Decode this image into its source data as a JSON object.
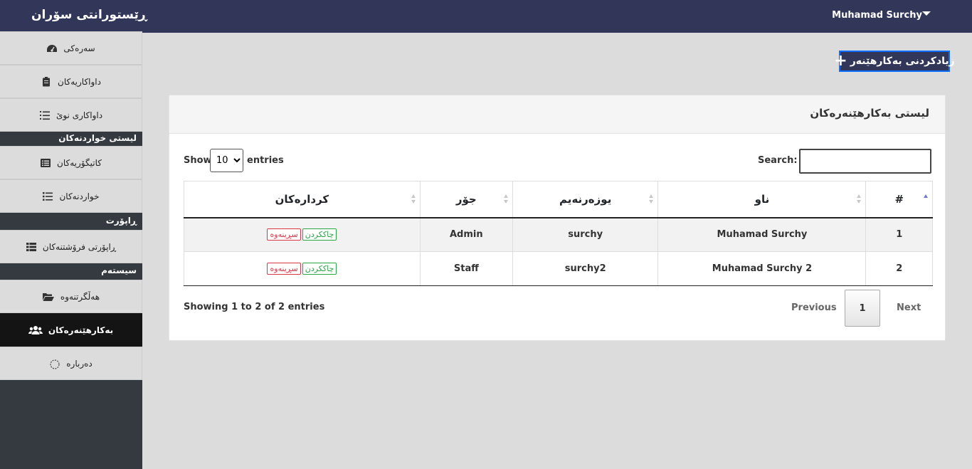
{
  "topbar": {
    "brand": "ڕێستورانتی سۆران",
    "user": "Muhamad Surchy"
  },
  "sidebar": {
    "items": [
      {
        "label": "سەرەکی",
        "icon": "dashboard-icon"
      },
      {
        "label": "داواکاریەکان",
        "icon": "clipboard-icon"
      },
      {
        "label": "داواکاری نوێ",
        "icon": "list-ol-icon"
      },
      {
        "label": "کاتیگۆریەکان",
        "icon": "list-alt-icon"
      },
      {
        "label": "خواردنەکان",
        "icon": "list-icon"
      },
      {
        "label": "ڕاپۆرتی فرۆشتنەکان",
        "icon": "th-list-icon"
      },
      {
        "label": "هەڵگرتنەوە",
        "icon": "folder-open-icon"
      },
      {
        "label": "بەکارهێنەرەکان",
        "icon": "users-icon"
      },
      {
        "label": "دەربارە",
        "icon": "circle-notch-icon"
      }
    ],
    "headers": [
      "لیستی خواردنەکان",
      "ڕاپۆرت",
      "سیستەم"
    ]
  },
  "add_button": {
    "label": "زیادکردنی بەکارهێنەر"
  },
  "card": {
    "title": "لیستی بەکارهێنەرەکان"
  },
  "datatable": {
    "show_label": "Show",
    "length_value": "10",
    "entries_label": "entries",
    "search_label": "Search:",
    "columns": [
      "#",
      "ناو",
      "یوزەرنەیم",
      "جۆر",
      "کردارەکان"
    ],
    "rows": [
      {
        "id": "1",
        "name": "Muhamad Surchy",
        "username": "surchy",
        "type": "Admin"
      },
      {
        "id": "2",
        "name": "Muhamad Surchy 2",
        "username": "surchy2",
        "type": "Staff"
      }
    ],
    "edit_label": "چاککردن",
    "delete_label": "سڕینەوە",
    "info": "Showing 1 to 2 of 2 entries",
    "prev_label": "Previous",
    "page": "1",
    "next_label": "Next"
  }
}
